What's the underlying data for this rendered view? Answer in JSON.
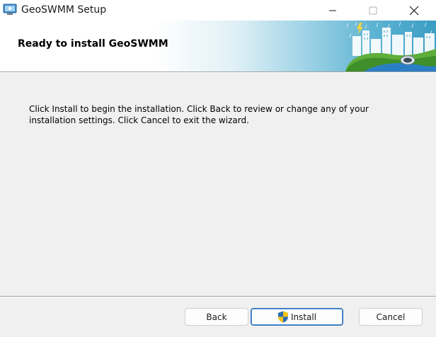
{
  "window": {
    "title": "GeoSWMM Setup",
    "controls": {
      "minimize_icon": "minimize-icon",
      "maximize_icon": "maximize-icon",
      "close_icon": "close-icon"
    }
  },
  "banner": {
    "title": "Ready to install GeoSWMM"
  },
  "body": {
    "message": "Click Install to begin the installation. Click Back to review or change any of your installation settings. Click Cancel to exit the wizard."
  },
  "buttons": {
    "back": "Back",
    "install": "Install",
    "cancel": "Cancel"
  },
  "colors": {
    "window_bg": "#f0f0f0",
    "banner_accent": "#3a9cc4",
    "default_button_border": "#2b6cb3"
  }
}
